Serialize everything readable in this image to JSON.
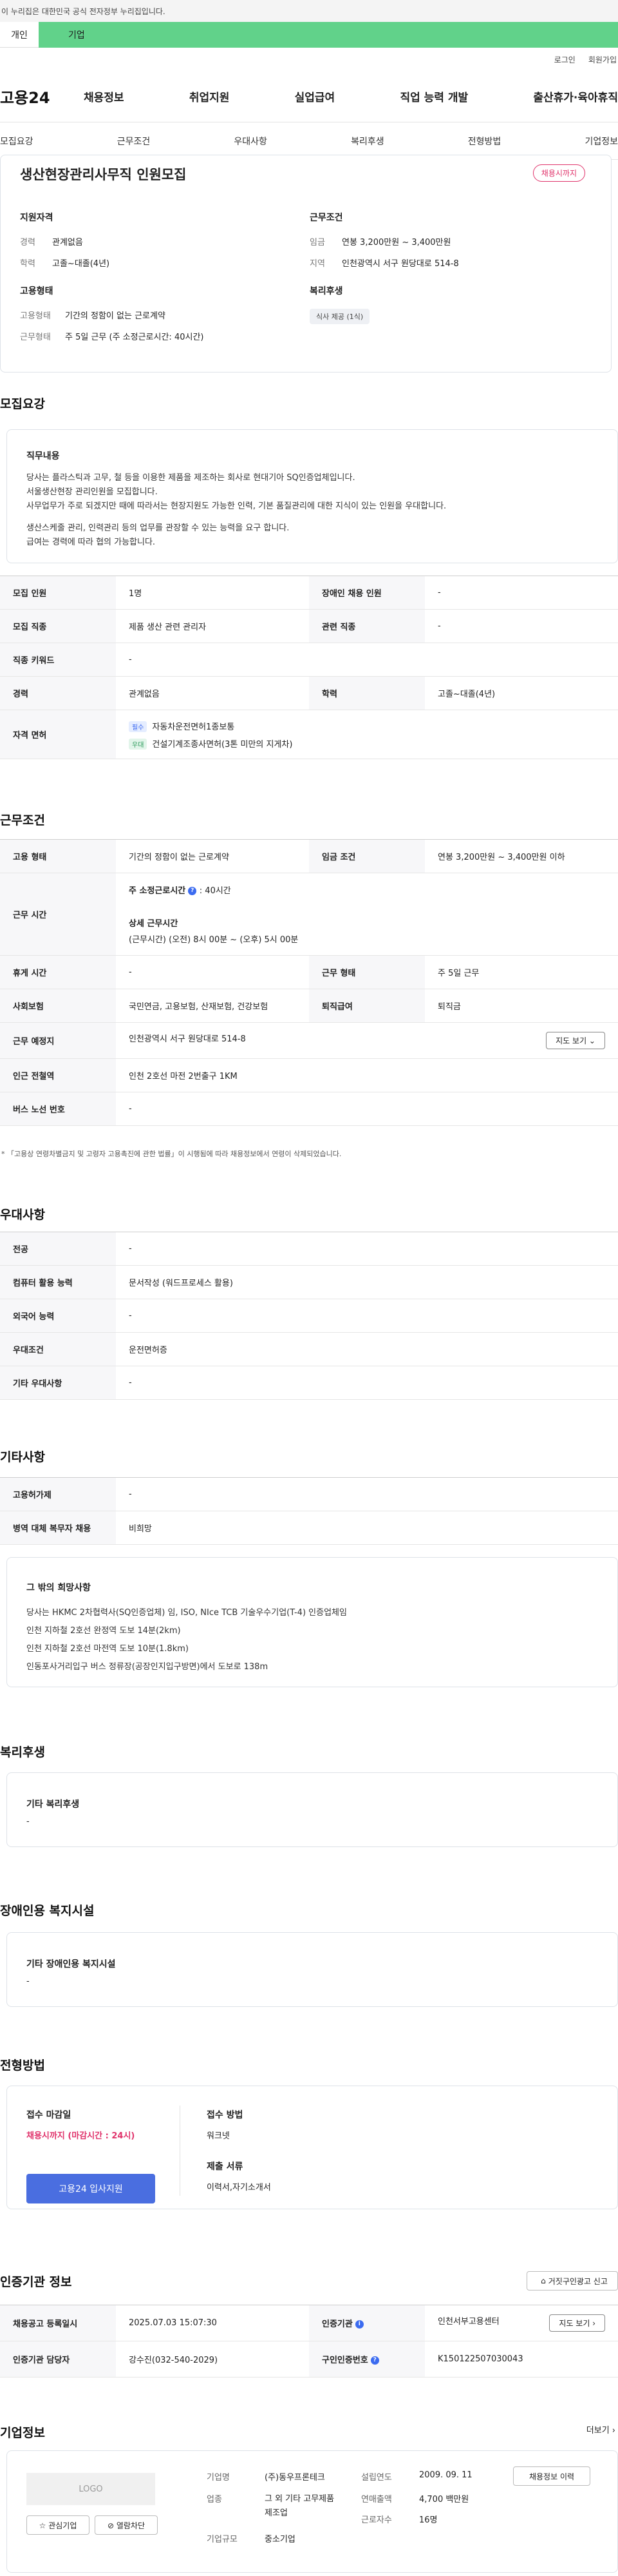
{
  "gov_bar": "이 누리집은 대한민국 공식 전자정부 누리집입니다.",
  "type_tabs": [
    "개인",
    "기업"
  ],
  "util": [
    "로그인",
    "회원가입"
  ],
  "logo": "고용24",
  "gnb": [
    "채용정보",
    "취업지원",
    "실업급여",
    "직업 능력 개발",
    "출산휴가·육아휴직"
  ],
  "subnav": [
    "모집요강",
    "근무조건",
    "우대사항",
    "복리후생",
    "전형방법",
    "기업정보"
  ],
  "job": {
    "title": "생산현장관리사무직 인원모집",
    "badge": "채용시까지",
    "qual_h": "지원자격",
    "cond_h": "근무조건",
    "emp_h": "고용형태",
    "welfare_h": "복리후생",
    "qual": [
      {
        "k": "경력",
        "v": "관계없음"
      },
      {
        "k": "학력",
        "v": "고졸~대졸(4년)"
      }
    ],
    "cond": [
      {
        "k": "임금",
        "v": "연봉 3,200만원 ~ 3,400만원"
      },
      {
        "k": "지역",
        "v": "인천광역시 서구 원당대로 514-8"
      }
    ],
    "emp": [
      {
        "k": "고용형태",
        "v": "기간의 정함이 없는 근로계약"
      },
      {
        "k": "근무형태",
        "v": "주 5일 근무 (주 소정근로시간: 40시간)"
      }
    ],
    "welfare_chip": "식사 제공 (1식)"
  },
  "recruit": {
    "title": "모집요강",
    "duty_h": "직무내용",
    "duty_lines": [
      "당사는 플라스틱과 고무, 철 등을 이용한 제품을 제조하는 회사로 현대기아 SQ인증업체입니다.",
      "서울생산현장 관리인원을 모집합니다.",
      "사무업무가 주로 되겠지만 때에 따라서는 현장지원도 가능한 인력, 기본 품질관리에 대한 지식이 있는 인원을 우대합니다.",
      "",
      "생산스케줄 관리, 인력관리 등의 업무를 관장할 수 있는 능력을 요구 합니다.",
      "급여는 경력에 따라 협의 가능합니다."
    ],
    "rows": [
      [
        {
          "k": "모집 인원",
          "v": "1명"
        },
        {
          "k": "장애인 채용 인원",
          "v": "-"
        }
      ],
      [
        {
          "k": "모집 직종",
          "v": "제품 생산 관련 관리자"
        },
        {
          "k": "관련 직종",
          "v": "-"
        }
      ],
      [
        {
          "k": "직종 키워드",
          "v": "-"
        }
      ],
      [
        {
          "k": "경력",
          "v": "관계없음"
        },
        {
          "k": "학력",
          "v": "고졸~대졸(4년)"
        }
      ]
    ],
    "license_k": "자격 면허",
    "license": [
      {
        "tag": "필수",
        "v": "자동차운전면허1종보통"
      },
      {
        "tag": "우대",
        "v": "건설기계조종사면허(3톤 미만의 지게차)"
      }
    ]
  },
  "work": {
    "title": "근무조건",
    "r1": [
      {
        "k": "고용 형태",
        "v": "기간의 정함이 없는 근로계약"
      },
      {
        "k": "임금 조건",
        "v": "연봉 3,200만원 ~ 3,400만원 이하"
      }
    ],
    "hours_k": "근무 시간",
    "hours_main": "주 소정근로시간",
    "hours_main_v": ": 40시간",
    "hours_detail_h": "상세 근무시간",
    "hours_detail": "(근무시간) (오전) 8시 00분 ~ (오후) 5시 00분",
    "r3": [
      {
        "k": "휴게 시간",
        "v": "-"
      },
      {
        "k": "근무 형태",
        "v": "주 5일 근무"
      }
    ],
    "r4": [
      {
        "k": "사회보험",
        "v": "국민연금, 고용보험, 산재보험, 건강보험"
      },
      {
        "k": "퇴직급여",
        "v": "퇴직금"
      }
    ],
    "place_k": "근무 예정지",
    "place_v": "인천광역시 서구 원당대로 514-8",
    "map_btn": "지도 보기 ⌄",
    "subway_k": "인근 전철역",
    "subway_v": "인천 2호선 마전 2번출구 1KM",
    "bus_k": "버스 노선 번호",
    "bus_v": "-",
    "note": "* 「고용상 연령차별금지 및 고령자 고용촉진에 관한 법률」이 시행됨에 따라 채용정보에서 연령이 삭제되었습니다."
  },
  "pref": {
    "title": "우대사항",
    "rows": [
      {
        "k": "전공",
        "v": "-"
      },
      {
        "k": "컴퓨터 활용 능력",
        "v": "문서작성 (워드프로세스 활용)"
      },
      {
        "k": "외국어 능력",
        "v": "-"
      },
      {
        "k": "우대조건",
        "v": "운전면허증"
      },
      {
        "k": "기타 우대사항",
        "v": "-"
      }
    ]
  },
  "etc": {
    "title": "기타사항",
    "rows": [
      {
        "k": "고용허가제",
        "v": "-"
      },
      {
        "k": "병역 대체 복무자 채용",
        "v": "비희망"
      }
    ],
    "other_h": "그 밖의 희망사항",
    "other_lines": [
      "당사는 HKMC 2차협력사(SQ인증업체) 임, ISO, NIce TCB 기술우수기업(T-4) 인증업체임",
      "인천 지하철 2호선 완정역 도보 14분(2km)",
      "인천 지하철 2호선 마전역 도보 10분(1.8km)",
      "인동포사거리입구 버스 정류장(공장인지입구방면)에서 도보로 138m"
    ]
  },
  "welfare": {
    "title": "복리후생",
    "h": "기타 복리후생",
    "v": "-"
  },
  "disab": {
    "title": "장애인용 복지시설",
    "h": "기타 장애인용 복지시설",
    "v": "-"
  },
  "process": {
    "title": "전형방법",
    "deadline_h": "접수 마감일",
    "deadline_v": "채용시까지 (마감시간 : 24시)",
    "apply_btn": "고용24 입사지원",
    "method_h": "접수 방법",
    "method_v": "워크넷",
    "docs_h": "제출 서류",
    "docs_v": "이력서,자기소개서"
  },
  "cert": {
    "title": "인증기관 정보",
    "report_btn": "거짓구인광고 신고",
    "r1": [
      {
        "k": "채용공고 등록일시",
        "v": "2025.07.03 15:07:30"
      },
      {
        "k": "인증기관",
        "v": "인천서부고용센터"
      }
    ],
    "map_btn": "지도 보기 ›",
    "r2": [
      {
        "k": "인증기관 담당자",
        "v": "강수진(032-540-2029)"
      },
      {
        "k": "구인인증번호",
        "v": "K150122507030043"
      }
    ]
  },
  "company": {
    "title": "기업정보",
    "more": "더보기 ›",
    "logo": "LOGO",
    "fav_btn": "☆ 관심기업",
    "block_btn": "⊘ 열람차단",
    "fields": [
      {
        "k": "기업명",
        "v": "(주)동우프론테크"
      },
      {
        "k": "업종",
        "v": "그 외 기타 고무제품 제조업"
      },
      {
        "k": "기업규모",
        "v": "중소기업"
      }
    ],
    "fields2": [
      {
        "k": "설립연도",
        "v": "2009. 09. 11"
      },
      {
        "k": "연매출액",
        "v": "4,700 백만원"
      },
      {
        "k": "근로자수",
        "v": "16명"
      }
    ],
    "history_btn": "채용정보 이력"
  },
  "colors": {
    "accent": "#4a6ee0",
    "green_tab": "#61d28a",
    "red": "#e0336b"
  }
}
